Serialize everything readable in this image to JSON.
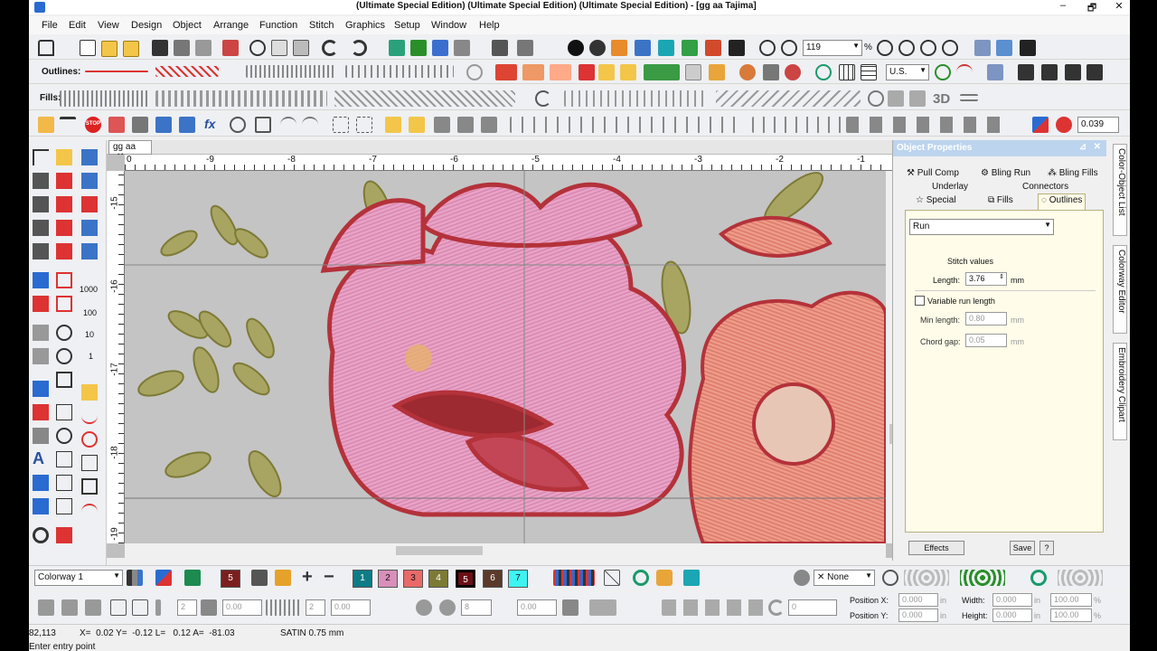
{
  "title": "(Ultimate Special Edition) (Ultimate Special Edition) (Ultimate Special Edition) - [gg aa      Tajima]",
  "window_controls": [
    "–",
    "🗗",
    "✕"
  ],
  "menu": [
    "File",
    "Edit",
    "View",
    "Design",
    "Object",
    "Arrange",
    "Function",
    "Stitch",
    "Graphics",
    "Setup",
    "Window",
    "Help"
  ],
  "toolbar": {
    "zoom_value": "119",
    "zoom_unit": "%",
    "units_value": "U.S.",
    "outlines_label": "Outlines:",
    "fills_label": "Fills:",
    "misc_value": "0.039",
    "stop_label": "STOP",
    "text_3d": "3D",
    "fx": "fx"
  },
  "doc_tab": {
    "label": "gg aa",
    "close": "✕"
  },
  "ruler": {
    "h_labels": [
      "0",
      "-9",
      "-8",
      "-7",
      "-6",
      "-5",
      "-4",
      "-3",
      "-2",
      "-1"
    ],
    "v_labels": [
      "-15",
      "-16",
      "-17",
      "-18",
      "-19"
    ]
  },
  "left_tools_text": [
    "A",
    "1000",
    "100",
    "10",
    "1"
  ],
  "object_properties": {
    "title": "Object Properties",
    "pin": "⊿",
    "close": "✕",
    "tabs_row1": [
      "Pull Comp",
      "Bling Run",
      "Bling Fills"
    ],
    "tabs_row2": [
      "Underlay",
      "Connectors"
    ],
    "tabs_row3": [
      "Special",
      "Fills",
      "Outlines"
    ],
    "type_value": "Run",
    "stitch_values_label": "Stitch values",
    "length_label": "Length:",
    "length_value": "3.76",
    "unit": "mm",
    "variable_run_label": "Variable run length",
    "min_length_label": "Min length:",
    "min_length_value": "0.80",
    "chord_gap_label": "Chord gap:",
    "chord_gap_value": "0.05",
    "effects_btn": "Effects",
    "save_btn": "Save",
    "help_btn": "?"
  },
  "side_tabs": [
    "Color-Object List",
    "Colorway Editor",
    "Embroidery Clipart"
  ],
  "colorway": {
    "value": "Colorway 1",
    "swatches": [
      {
        "label": "5",
        "color": "#7a1f1f"
      },
      {
        "label": "1",
        "color": "#0e7c86"
      },
      {
        "label": "2",
        "color": "#d88fb8"
      },
      {
        "label": "3",
        "color": "#e96a68"
      },
      {
        "label": "4",
        "color": "#7d7a36"
      },
      {
        "label": "5",
        "color": "#6b0f15"
      },
      {
        "label": "6",
        "color": "#5a3a2a"
      },
      {
        "label": "7",
        "color": "#3ff3f3"
      }
    ],
    "none_label": "None"
  },
  "transform": {
    "posx_label": "Position X:",
    "posy_label": "Position Y:",
    "posx_value": "0.000",
    "posy_value": "0.000",
    "width_label": "Width:",
    "height_label": "Height:",
    "width_value": "0.000",
    "height_value": "0.000",
    "unit": "in",
    "pct1": "100.00",
    "pct2": "100.00",
    "pct_unit": "%",
    "zero_values": [
      "2",
      "0.00",
      "2",
      "0.00",
      "8",
      "0.00",
      "0",
      "0"
    ]
  },
  "status": {
    "coords": "82,113",
    "xy": "X=  0.02 Y=  -0.12 L=   0.12 A=  -81.03",
    "stitch": "SATIN  0.75 mm",
    "prompt": "Enter entry point"
  },
  "colors": {
    "accent": "#2a6bd1",
    "panel_bg": "#fffde9",
    "canvas_bg": "#c6c6c6"
  }
}
